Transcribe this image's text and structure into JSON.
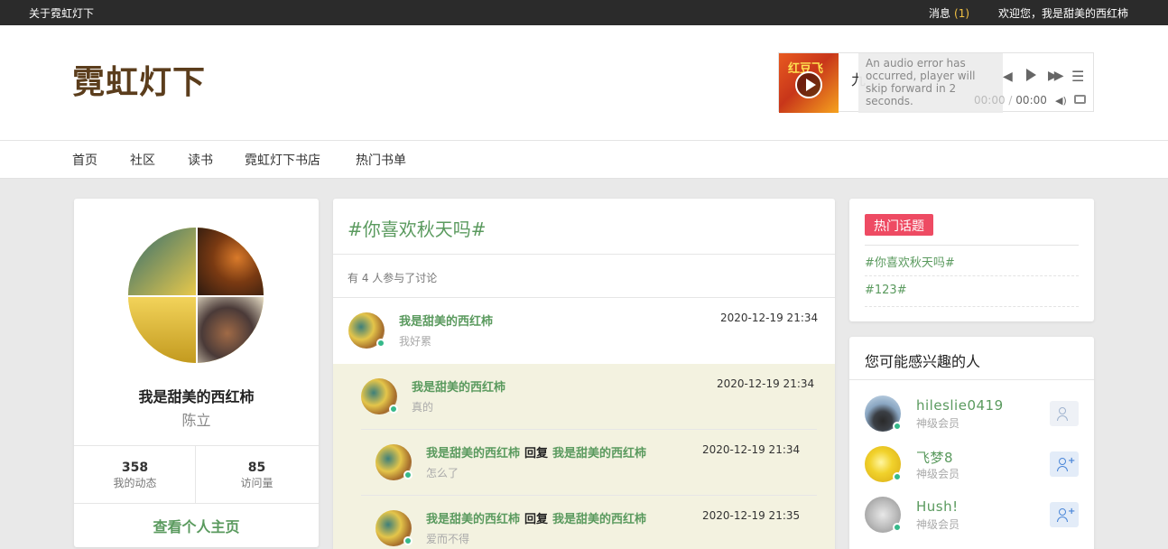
{
  "topbar": {
    "about": "关于霓虹灯下",
    "messages_label": "消息",
    "messages_count": "(1)",
    "welcome": "欢迎您，我是甜美的西红柿"
  },
  "header": {
    "logo": "霓虹灯下"
  },
  "player": {
    "cover_text": "红豆飞",
    "song_title": "九",
    "error_text": "An audio error has occurred, player will skip forward in 2 seconds.",
    "current_time": "00:00",
    "time_separator": "/",
    "total_time": "00:00"
  },
  "nav": {
    "items": [
      "首页",
      "社区",
      "读书",
      "霓虹灯下书店",
      "热门书单"
    ]
  },
  "profile": {
    "name": "我是甜美的西红柿",
    "real_name": "陈立",
    "posts_count": "358",
    "posts_label": "我的动态",
    "visits_count": "85",
    "visits_label": "访问量",
    "homepage_link": "查看个人主页"
  },
  "topic": {
    "title": "#你喜欢秋天吗#",
    "participants": "有 4 人参与了讨论",
    "reply_word": "回复",
    "comments": [
      {
        "author": "我是甜美的西红柿",
        "reply_to": "",
        "text": "我好累",
        "time": "2020-12-19 21:34"
      },
      {
        "author": "我是甜美的西红柿",
        "reply_to": "",
        "text": "真的",
        "time": "2020-12-19 21:34"
      },
      {
        "author": "我是甜美的西红柿",
        "reply_to": "我是甜美的西红柿",
        "text": "怎么了",
        "time": "2020-12-19 21:34"
      },
      {
        "author": "我是甜美的西红柿",
        "reply_to": "我是甜美的西红柿",
        "text": "爱而不得",
        "time": "2020-12-19 21:35"
      }
    ]
  },
  "hot_topics": {
    "badge": "热门话题",
    "items": [
      "#你喜欢秋天吗#",
      "#123#"
    ]
  },
  "people": {
    "title": "您可能感兴趣的人",
    "items": [
      {
        "name": "hileslie0419",
        "level": "神级会员"
      },
      {
        "name": "飞梦8",
        "level": "神级会员"
      },
      {
        "name": "Hush!",
        "level": "神级会员"
      }
    ]
  },
  "colors": {
    "accent_green": "#5a9a5e",
    "badge_red": "#ee4b63",
    "logo_brown": "#5b3d1c",
    "topbar_bg": "#2b2b2b",
    "reply_bg": "#f3f2e0",
    "online_dot": "#36b98a"
  }
}
